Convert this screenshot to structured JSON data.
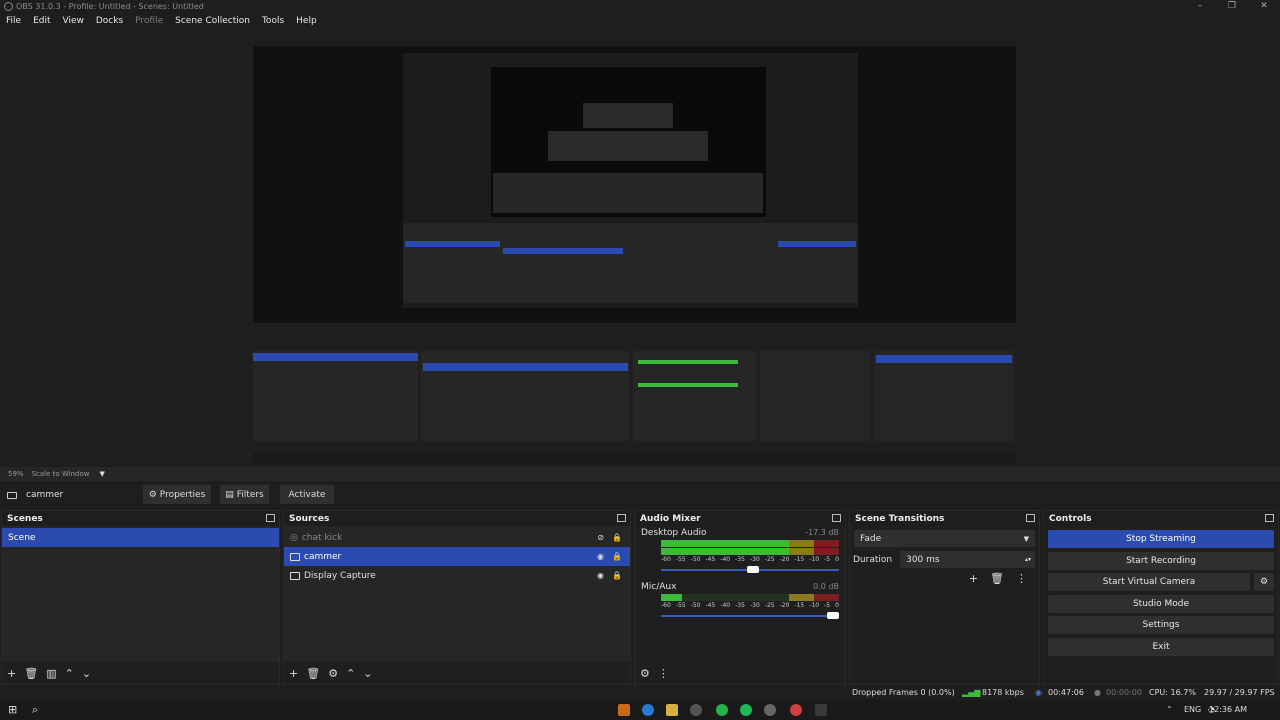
{
  "window": {
    "title": "OBS 31.0.3 - Profile: Untitled - Scenes: Untitled"
  },
  "menu": [
    "File",
    "Edit",
    "View",
    "Docks",
    "Profile",
    "Scene Collection",
    "Tools",
    "Help"
  ],
  "preview": {
    "zoom": "59%",
    "scale_mode": "Scale to Window"
  },
  "source_bar": {
    "source_name": "cammer",
    "properties": "Properties",
    "filters": "Filters",
    "activate": "Activate"
  },
  "docks": {
    "scenes": {
      "title": "Scenes",
      "items": [
        {
          "label": "Scene",
          "selected": true
        }
      ]
    },
    "sources": {
      "title": "Sources",
      "items": [
        {
          "label": "chat kick",
          "icon": "browser-icon",
          "visible": false,
          "selected": false
        },
        {
          "label": "cammer",
          "icon": "camera-icon",
          "visible": true,
          "selected": true
        },
        {
          "label": "Display Capture",
          "icon": "monitor-icon",
          "visible": true,
          "selected": false
        }
      ]
    },
    "audio_mixer": {
      "title": "Audio Mixer",
      "channels": [
        {
          "name": "Desktop Audio",
          "db": "-17.3 dB",
          "level": 0.88,
          "volume": 0.55
        },
        {
          "name": "Mic/Aux",
          "db": "0.0 dB",
          "level": 0.12,
          "volume": 1.0
        }
      ],
      "ticks": [
        "-60",
        "-55",
        "-50",
        "-45",
        "-40",
        "-35",
        "-30",
        "-25",
        "-20",
        "-15",
        "-10",
        "-5",
        "0"
      ]
    },
    "transitions": {
      "title": "Scene Transitions",
      "selected": "Fade",
      "duration_label": "Duration",
      "duration_value": "300 ms"
    },
    "controls": {
      "title": "Controls",
      "buttons": {
        "stop_streaming": "Stop Streaming",
        "start_recording": "Start Recording",
        "start_virtual_camera": "Start Virtual Camera",
        "studio_mode": "Studio Mode",
        "settings": "Settings",
        "exit": "Exit"
      }
    }
  },
  "status": {
    "dropped_frames": "Dropped Frames 0 (0.0%)",
    "bitrate": "8178 kbps",
    "stream_time": "00:47:06",
    "record_time": "00:00:00",
    "cpu": "CPU: 16.7%",
    "fps": "29.97 / 29.97 FPS"
  },
  "taskbar": {
    "language": "ENG",
    "time": "12:36 AM"
  }
}
